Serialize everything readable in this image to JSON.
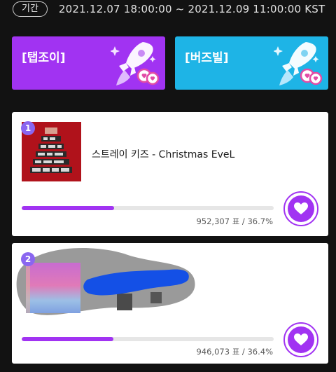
{
  "period": {
    "badge": "기간",
    "range": "2021.12.07 18:00:00 ~ 2021.12.09 11:00:00 KST"
  },
  "vote_buttons": [
    {
      "label": "[탭조이]",
      "color": "#a133f2",
      "icon": "rocket-icon"
    },
    {
      "label": "[버즈빌]",
      "color": "#1eb4e6",
      "icon": "rocket-icon"
    }
  ],
  "entries": [
    {
      "rank": "1",
      "title": "스트레이 키즈 - Christmas EveL",
      "votes_text": "952,307 표 / 36.7%",
      "percent": 36.7,
      "icon": "heart-icon"
    },
    {
      "rank": "2",
      "title": "",
      "votes_text": "946,073 표 / 36.4%",
      "percent": 36.4,
      "icon": "heart-icon"
    }
  ],
  "colors": {
    "accent_purple": "#a133f2",
    "accent_blue": "#1eb4e6",
    "background": "#121212"
  }
}
